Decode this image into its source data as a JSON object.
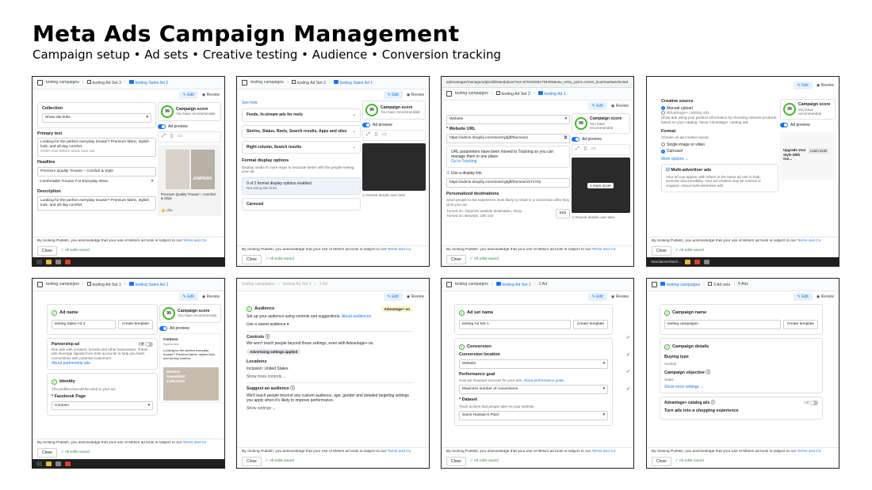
{
  "header": {
    "title": "Meta Ads Campaign Management",
    "subtitle": "Campaign setup • Ad sets • Creative testing • Audience • Conversion tracking"
  },
  "common": {
    "edit": "Edit",
    "review": "Review",
    "close": "Close",
    "saved": "All edits saved",
    "publish_notice": "By clicking Publish, you acknowledge that your use of Meta's ad tools is subject to our",
    "terms": "Terms and Co",
    "score_title": "Campaign score",
    "score_value": "99",
    "score_sub": "You have recommendati",
    "ad_preview": "Ad preview"
  },
  "shot1": {
    "crumbs": [
      "testing campaigns",
      "testing Ad Set 3",
      "testing Sales Ad 2"
    ],
    "collection_label": "Collection",
    "collection_value": "Show site links",
    "primary_label": "Primary text",
    "primary_text": "Looking for the perfect everyday trouser? Premium fabric, stylish look, and all-day comfort.",
    "primary_more": "Order now before stock runs out",
    "headline_label": "Headline",
    "headline1": "Premium Quality Trouser – Comfort & Style",
    "headline2": "Comfortable Trouser For Everyday Wear",
    "desc_label": "Description",
    "desc_text": "Looking for the perfect everyday trouser? Premium fabric, stylish look, and all-day comfort.",
    "brand": "JUMPERS",
    "prev_caption": "Premium Quality Trouser – Comfort & Style",
    "like": "Like"
  },
  "shot2": {
    "crumbs": [
      "testing campaigns",
      "testing Ad Set 2",
      "testing Sales Ad 1"
    ],
    "see_how": "See how",
    "placements": [
      "Feeds, In-stream ads for reels",
      "Stories, Status, Reels, Search results, Apps and sites",
      "Right column, Search results"
    ],
    "format_label": "Format display options",
    "format_sub": "Display media in more ways to resonate better with the people seeing your ad.",
    "format_count": "0 of 2 format display options enabled",
    "format_count_sub": "Not using site links",
    "carousel": "Carousel",
    "reveal": "Reveal details over time"
  },
  "shot3": {
    "url": "adsmanager/manage/adjs/edit/standalone?act=676192051794493&nav_entry_point=comet_bookmark&selected",
    "crumbs": [
      "testing campaigns",
      "testing Ad Set 2",
      "testing Ad 1"
    ],
    "website_select": "Website",
    "website_label": "Website URL",
    "website_url": "https://admin.shopify.com/store/rgfgff/themes/1",
    "param_note": "URL parameters have been moved to Tracking so you can manage them in one place.",
    "go_tracking": "Go to Tracking",
    "display_link": "Use a display link",
    "display_url": "https://admin.shopify.com/store/rgfgff/themes/1571702",
    "personalized_label": "Personalized destinations",
    "personalized_sub": "Send people to the experience most likely to result in a conversion after they click your ad.",
    "turned_on1": "Turned on: Optimize website destination, Shop",
    "turned_on2": "Turned on: Browser, with one",
    "edit_btn": "Edit",
    "more_score": "1 more score",
    "reveal": "Reveal details over time"
  },
  "shot4": {
    "creative_source": "Creative source",
    "manual": "Manual upload",
    "catalog": "Advantage+ catalog ads",
    "catalog_sub": "Show ads using your product information by choosing relevant products based on your catalog. About Advantage+ catalog ads",
    "format_label": "Format",
    "format_sub": "Choose an ad creative layout.",
    "single": "Single image or video",
    "carousel": "Carousel",
    "more_options": "More options",
    "multi_label": "Multi-advertiser ads",
    "multi_sub": "Your ad can appear with others in the same ad unit to help promote discoverability. Your ad creative may be resized or cropped. About multi-advertiser ads",
    "upgrade_text": "Upgrade Your Style With Our...",
    "learn_more": "Learn more",
    "taskbar_label": "Standalone/Sach..."
  },
  "shot5": {
    "crumbs": [
      "testing campaigns",
      "testing Ad Set 1",
      "testing Sales Ad 3"
    ],
    "adname_label": "Ad name",
    "adname_value": "testing Sales Ad 3",
    "create_template": "Create template",
    "partnership_label": "Partnership ad",
    "off": "Off",
    "partnership_sub": "Run ads with creators, brands and other businesses. These ads leverage signals from both accounts to help you build connections with potential customers.",
    "about_partnership": "About partnership ads",
    "identity_label": "Identity",
    "identity_sub": "The profiles that will be used in your ad.",
    "fb_page": "Facebook Page",
    "fb_value": "Contoso",
    "prev_brand": "Contoso",
    "prev_sponsored": "Sponsored",
    "prev_text": "Looking for the perfect everyday trouser? Premium fabric, stylish look, and all-day comfort.",
    "prev_overlay": "Modern Sweatshirt Collection"
  },
  "shot6": {
    "crumbs": [
      "testing campaigns",
      "testing Ad Set 1",
      "1 Ad"
    ],
    "audience_label": "Audience",
    "advantage_badge": "Advantage+ on",
    "audience_sub": "Set up your audience using controls and suggestions.",
    "about_audiences": "About audiences",
    "saved_audience": "Use a saved audience",
    "controls_label": "Controls",
    "controls_sub": "We won't reach people beyond these settings, even with Advantage+ on.",
    "adv_settings": "Advertising settings applied",
    "locations_label": "Locations",
    "locations_value": "Inclusion: United States",
    "show_more_controls": "Show more controls",
    "suggest_label": "Suggest an audience",
    "suggest_sub": "We'll reach people beyond any custom audience, age, gender and detailed targeting settings you apply when it's likely to improve performance.",
    "show_settings": "Show settings"
  },
  "shot7": {
    "crumbs": [
      "testing campaigns",
      "testing Ad Set 1",
      "1 Ad"
    ],
    "adset_label": "Ad set name",
    "adset_value": "testing Ad Set 1",
    "create_template": "Create template",
    "conversion_label": "Conversion",
    "conv_location_label": "Conversion location",
    "conv_location_value": "Website",
    "perf_label": "Performance goal",
    "perf_sub": "How we measure success for your ads.",
    "about_perf": "About performance goals",
    "perf_value": "Maximize number of conversions",
    "dataset_label": "Dataset",
    "dataset_sub": "Track actions that people take on your website.",
    "dataset_value": "Sams Hussain's Pixel"
  },
  "shot8": {
    "crumbs": [
      "testing-campaigns",
      "3 Ad sets",
      "9 Ads"
    ],
    "campaign_name_label": "Campaign name",
    "campaign_name_value": "testing campaigns",
    "create_template": "Create template",
    "details_label": "Campaign details",
    "buying_type_label": "Buying type",
    "buying_type_value": "Auction",
    "objective_label": "Campaign objective",
    "objective_value": "Sales",
    "show_more": "Show more settings",
    "adv_catalog": "Advantage+ catalog ads",
    "off": "Off",
    "shopping": "Turn ads into a shopping experience"
  }
}
